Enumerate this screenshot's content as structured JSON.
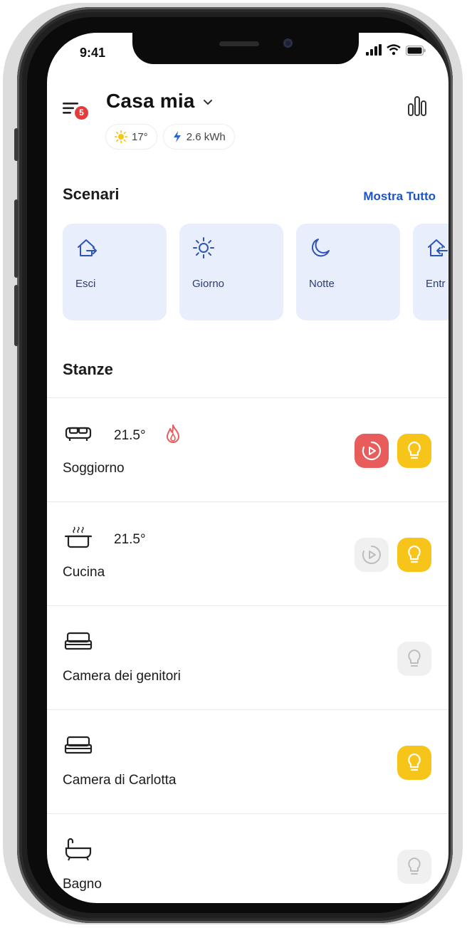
{
  "status_bar": {
    "time": "9:41"
  },
  "header": {
    "home_name": "Casa mia",
    "notification_count": "5",
    "weather_temp": "17°",
    "energy": "2.6 kWh"
  },
  "scenes": {
    "title": "Scenari",
    "show_all": "Mostra Tutto",
    "items": [
      {
        "label": "Esci",
        "icon": "leave-home-icon"
      },
      {
        "label": "Giorno",
        "icon": "sun-icon"
      },
      {
        "label": "Notte",
        "icon": "moon-icon"
      },
      {
        "label": "Entr",
        "icon": "enter-home-icon"
      }
    ]
  },
  "rooms": {
    "title": "Stanze",
    "items": [
      {
        "name": "Soggiorno",
        "temperature": "21.5°",
        "heating": true,
        "media": "active",
        "light": "on",
        "icon": "sofa-icon"
      },
      {
        "name": "Cucina",
        "temperature": "21.5°",
        "heating": false,
        "media": "inactive",
        "light": "on",
        "icon": "cooking-pot-icon"
      },
      {
        "name": "Camera dei genitori",
        "temperature": "",
        "heating": false,
        "media": "none",
        "light": "off",
        "icon": "bed-icon"
      },
      {
        "name": "Camera di Carlotta",
        "temperature": "",
        "heating": false,
        "media": "none",
        "light": "on",
        "icon": "bed-icon"
      },
      {
        "name": "Bagno",
        "temperature": "",
        "heating": false,
        "media": "none",
        "light": "off",
        "icon": "bathtub-icon"
      }
    ]
  },
  "colors": {
    "accent_blue": "#1c54c6",
    "scene_card_bg": "#e8eefc",
    "light_on": "#f7c51a",
    "light_off": "#f0f0f0",
    "media_active": "#e85c5c",
    "flame": "#e85c5c"
  }
}
